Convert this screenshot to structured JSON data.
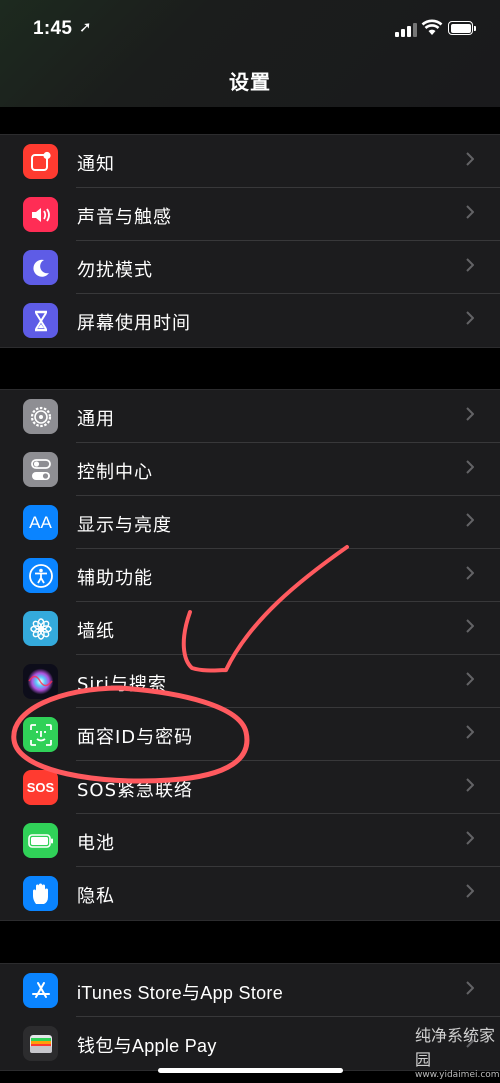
{
  "status_bar": {
    "time": "1:45",
    "location_glyph": "➚"
  },
  "nav": {
    "title": "设置"
  },
  "groups": [
    {
      "items": [
        {
          "label": "通知",
          "icon": "notifications-icon",
          "color": "#ff3b30"
        },
        {
          "label": "声音与触感",
          "icon": "sounds-icon",
          "color": "#ff2d55"
        },
        {
          "label": "勿扰模式",
          "icon": "do-not-disturb-icon",
          "color": "#5e5ce6"
        },
        {
          "label": "屏幕使用时间",
          "icon": "screen-time-icon",
          "color": "#5e5ce6"
        }
      ]
    },
    {
      "items": [
        {
          "label": "通用",
          "icon": "gear-icon",
          "color": "#8e8e93"
        },
        {
          "label": "控制中心",
          "icon": "control-center-icon",
          "color": "#8e8e93"
        },
        {
          "label": "显示与亮度",
          "icon": "display-icon",
          "color": "#0a84ff",
          "icon_text": "AA"
        },
        {
          "label": "辅助功能",
          "icon": "accessibility-icon",
          "color": "#0a84ff"
        },
        {
          "label": "墙纸",
          "icon": "wallpaper-icon",
          "color": "#34aadc"
        },
        {
          "label": "Siri与搜索",
          "icon": "siri-icon",
          "color": "#1c1c3a"
        },
        {
          "label": "面容ID与密码",
          "icon": "face-id-icon",
          "color": "#30d158"
        },
        {
          "label": "SOS紧急联络",
          "icon": "sos-icon",
          "color": "#ff3b30",
          "icon_text": "SOS"
        },
        {
          "label": "电池",
          "icon": "battery-icon",
          "color": "#30d158"
        },
        {
          "label": "隐私",
          "icon": "privacy-hand-icon",
          "color": "#0a84ff"
        }
      ]
    },
    {
      "items": [
        {
          "label": "iTunes Store与App Store",
          "icon": "app-store-icon",
          "color": "#0a84ff"
        },
        {
          "label": "钱包与Apple Pay",
          "icon": "wallet-icon",
          "color": "#2c2c2e"
        }
      ]
    }
  ],
  "watermark": {
    "text": "纯净系统家园",
    "url": "www.yidaimei.com"
  }
}
